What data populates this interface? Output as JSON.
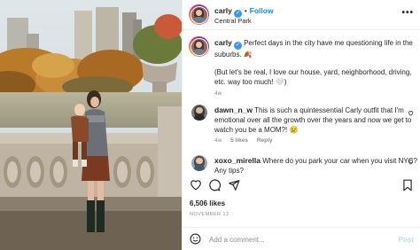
{
  "header": {
    "username": "carly",
    "follow_label": "Follow",
    "separator": "•",
    "location": "Central Park",
    "more_label": "•••"
  },
  "caption": {
    "username": "carly",
    "line1": "Perfect days in the city have me questioning life in the",
    "line2": "suburbs. 🍂",
    "line3": "(But let's be real, I love our house, yard, neighborhood, driving,",
    "line4": "etc. way too much! 🤍)",
    "time": "4w"
  },
  "comments": [
    {
      "username": "dawn_n_w",
      "line1": "This is such a quintessential Carly outfit that I'm",
      "line2": "emotional over all the growth over the years and now we get to",
      "line3": "watch you be a MOM?! 😢",
      "time": "4w",
      "likes": "5 likes",
      "reply": "Reply"
    },
    {
      "username": "xoxo_mirella",
      "line1": "Where do you park your car when you visit NYC?",
      "line2": "Any tips?"
    }
  ],
  "stats": {
    "likes": "6,506 likes",
    "date": "NOVEMBER 12"
  },
  "comment_box": {
    "placeholder": "Add a comment...",
    "post_label": "Post"
  },
  "icons": {
    "like": "heart-icon",
    "comment": "comment-icon",
    "share": "share-icon",
    "save": "bookmark-icon",
    "emoji": "emoji-icon",
    "verified": "verified-badge-icon"
  },
  "colors": {
    "follow": "#0095f6",
    "verified": "#3897f0",
    "muted": "#8e8e8e",
    "post_disabled": "#b3dbff"
  }
}
